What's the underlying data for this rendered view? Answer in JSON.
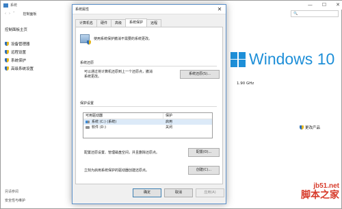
{
  "background_window": {
    "title": "系统",
    "controls": [
      "—",
      "☐",
      "✕"
    ],
    "address_path": "控制面板",
    "sidebar_home": "控制面板主页",
    "sidebar_links": [
      "设备管理器",
      "远程设置",
      "系统保护",
      "高级系统设置"
    ],
    "see_also": "另请参阅",
    "see_also_link": "安全性与维护",
    "windows_brand": "Windows 10",
    "cpu_speed": "1.90 GHz",
    "change_product_key": "更改产品"
  },
  "dialog": {
    "title": "系统属性",
    "close_icon": "✕",
    "tabs": [
      "计算机名",
      "硬件",
      "高级",
      "系统保护",
      "远程"
    ],
    "active_tab": "系统保护",
    "intro_text": "使用系统保护撤消不需要的系统更改。",
    "restore_section_label": "系统还原",
    "restore_desc_line1": "可以通过将计算机还原到上一个还原点，撤消",
    "restore_desc_line2": "系统更改。",
    "restore_button": "系统还原(S)...",
    "protection_section_label": "保护设置",
    "drive_col_header": "可用驱动器",
    "protection_col_header": "保护",
    "drives": [
      {
        "name": "系统 (C:) (系统)",
        "status": "启用"
      },
      {
        "name": "软件 (D:)",
        "status": "关闭"
      }
    ],
    "configure_desc": "配置还原设置、管理磁盘空间，并且删除还原点。",
    "configure_button": "配置(O)...",
    "create_desc": "立刻为启用系统保护的驱动器创建还原点。",
    "create_button": "创建(C)...",
    "ok_button": "确定",
    "cancel_button": "取消",
    "apply_button": "应用(A)"
  },
  "watermark": {
    "site": "jb51.net",
    "brand": "脚本之家"
  }
}
